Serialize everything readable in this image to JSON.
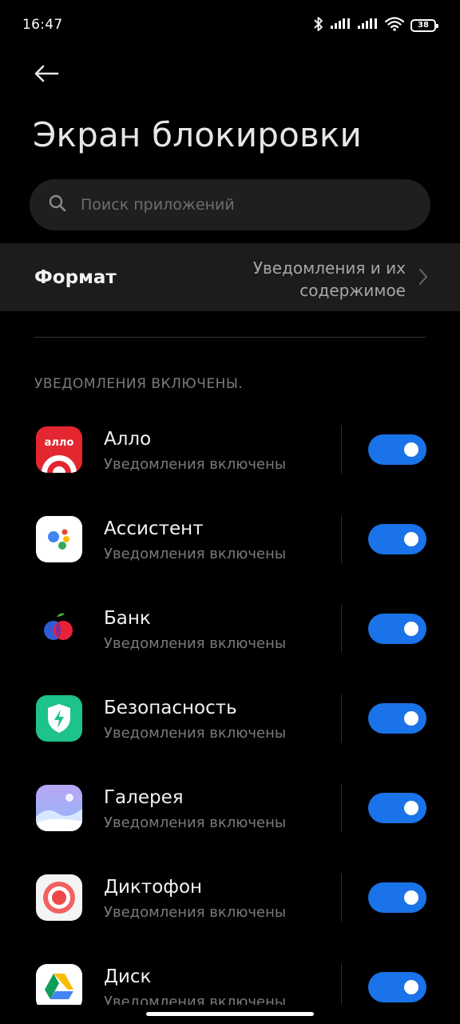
{
  "status_bar": {
    "time": "16:47",
    "battery_level": "38",
    "icons": [
      "bluetooth-icon",
      "signal-icon",
      "signal-icon",
      "wifi-icon",
      "battery-icon"
    ]
  },
  "header": {
    "back_icon": "arrow-left-icon",
    "title": "Экран блокировки"
  },
  "search": {
    "icon": "search-icon",
    "placeholder": "Поиск приложений",
    "value": ""
  },
  "format": {
    "label": "Формат",
    "value_line1": "Уведомления и их",
    "value_line2": "содержимое",
    "chevron_icon": "chevron-right-icon"
  },
  "section": {
    "header": "УВЕДОМЛЕНИЯ ВКЛЮЧЕНЫ."
  },
  "colors": {
    "background": "#000000",
    "toggle_on": "#1a73e8",
    "format_row_bg": "#1c1c1c",
    "search_bg": "#1f1f1f"
  },
  "apps": [
    {
      "name": "Алло",
      "status": "Уведомления включены",
      "icon": "allo-app-icon",
      "enabled": true
    },
    {
      "name": "Ассистент",
      "status": "Уведомления включены",
      "icon": "assistant-app-icon",
      "enabled": true
    },
    {
      "name": "Банк",
      "status": "Уведомления включены",
      "icon": "bank-app-icon",
      "enabled": true
    },
    {
      "name": "Безопасность",
      "status": "Уведомления включены",
      "icon": "security-app-icon",
      "enabled": true
    },
    {
      "name": "Галерея",
      "status": "Уведомления включены",
      "icon": "gallery-app-icon",
      "enabled": true
    },
    {
      "name": "Диктофон",
      "status": "Уведомления включены",
      "icon": "recorder-app-icon",
      "enabled": true
    },
    {
      "name": "Диск",
      "status": "Уведомления включены",
      "icon": "drive-app-icon",
      "enabled": true
    }
  ]
}
